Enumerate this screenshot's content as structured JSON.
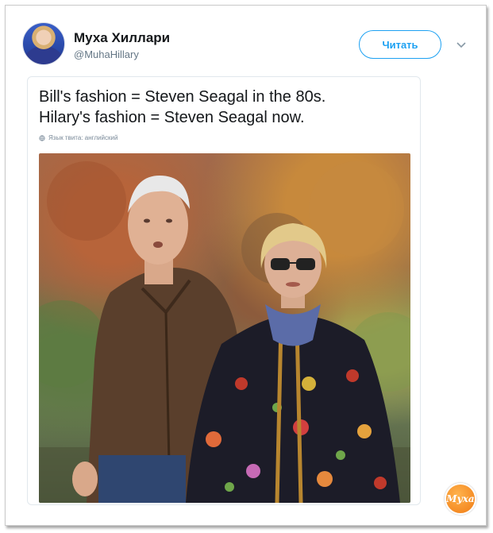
{
  "author": {
    "display_name": "Муха Хиллари",
    "handle": "@MuhaHillary",
    "avatar_icon": "avatar-photo"
  },
  "actions": {
    "follow_label": "Читать",
    "menu_icon": "chevron-down-icon"
  },
  "tweet": {
    "text_line_1": "Bill's fashion = Steven Seagal in the 80s.",
    "text_line_2": "Hilary's fashion = Steven Seagal now.",
    "language_note": "Язык твита: английский"
  },
  "watermark": {
    "text": "Муха"
  },
  "colors": {
    "accent": "#1da1f2",
    "text": "#14171a",
    "secondary": "#657786",
    "watermark": "#f07b14"
  }
}
